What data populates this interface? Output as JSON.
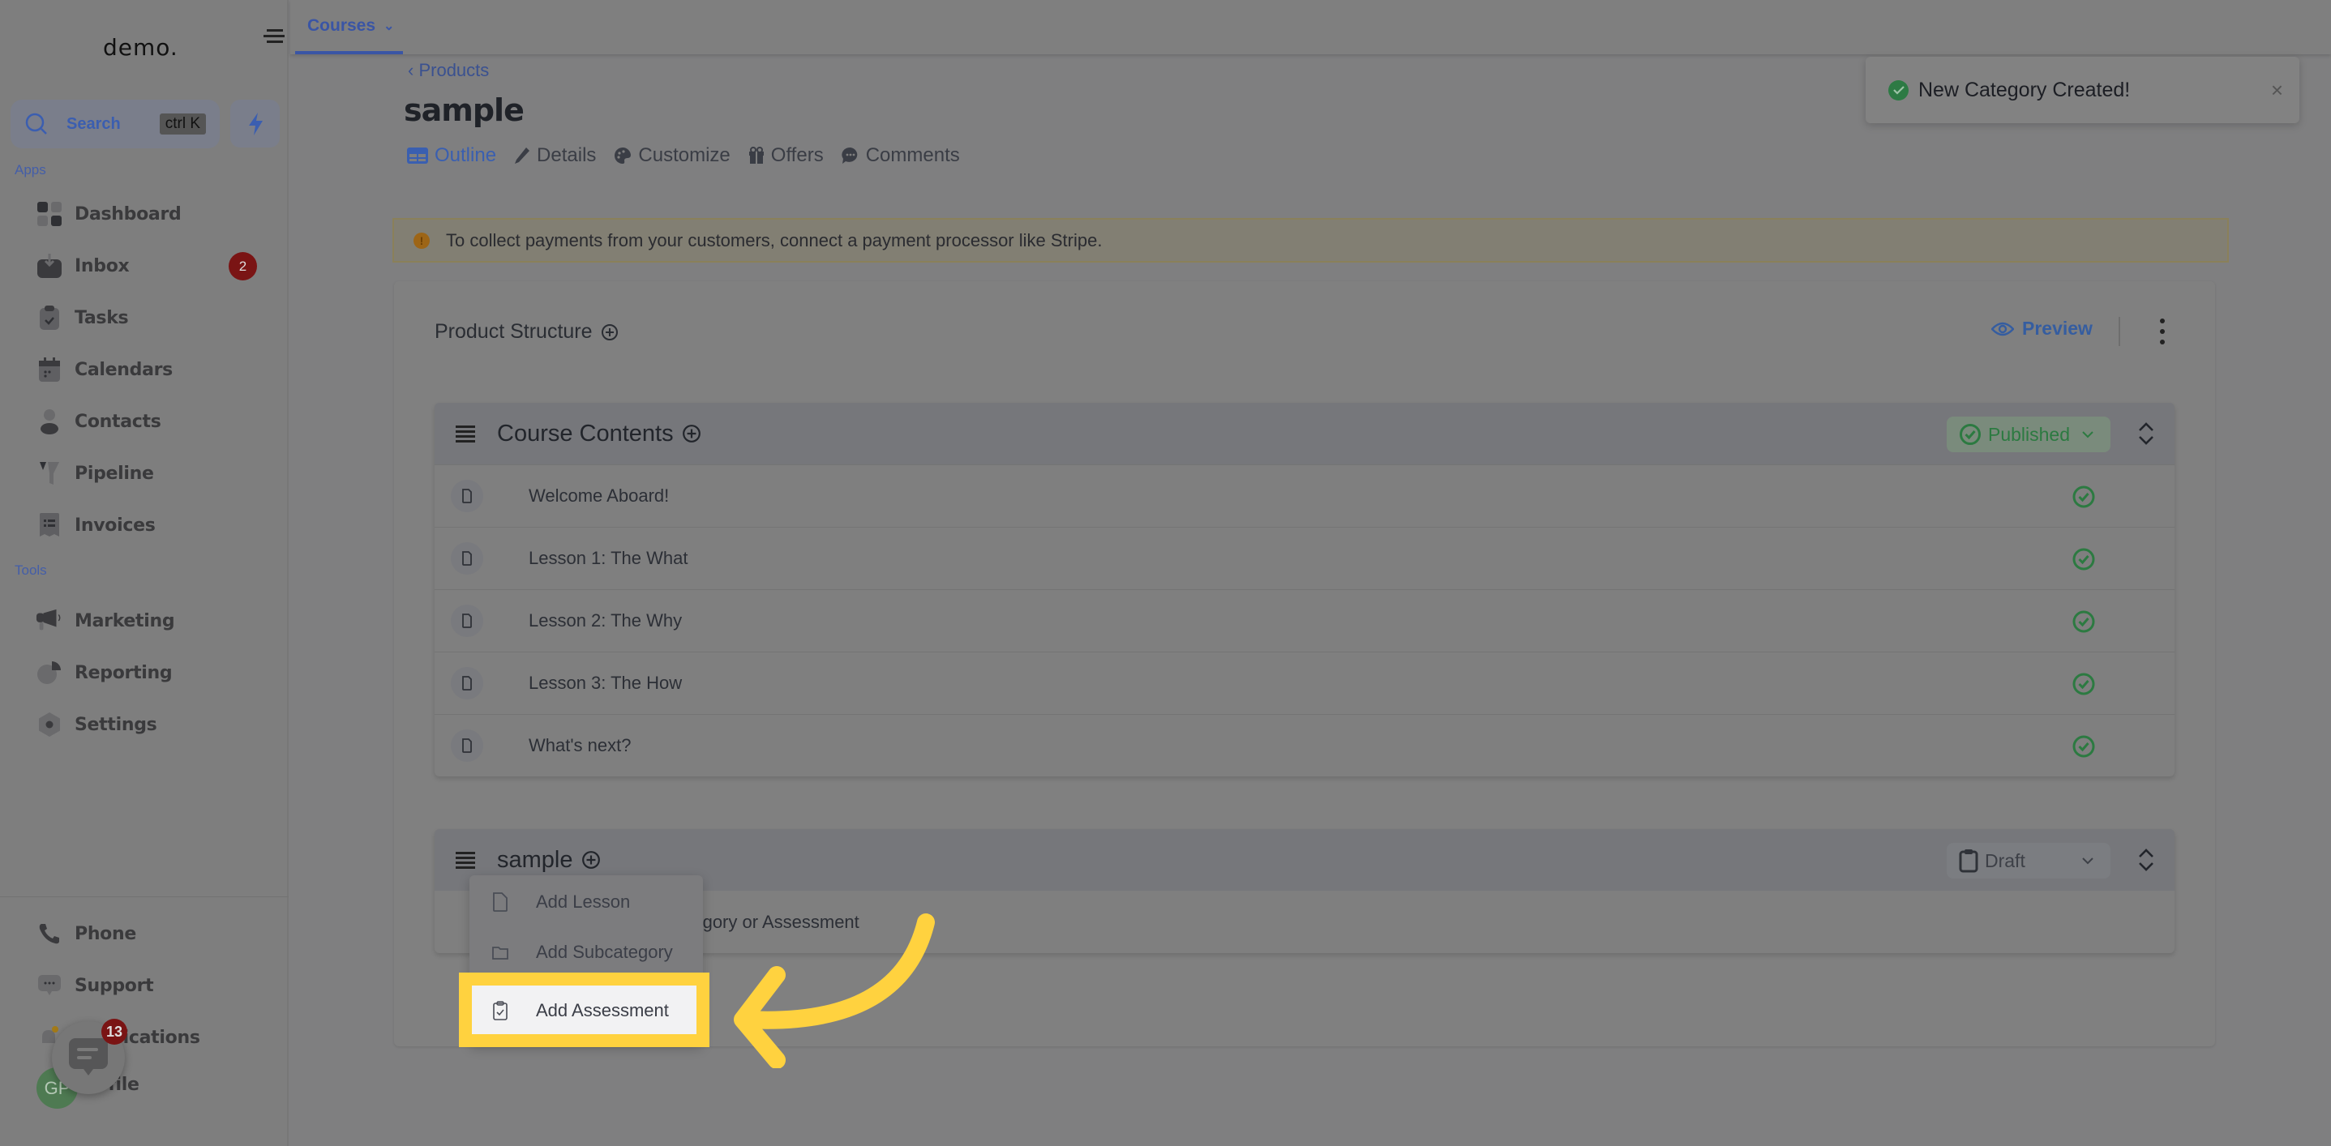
{
  "app": {
    "logo": "demo.",
    "search": {
      "label": "Search",
      "shortcut": "ctrl K"
    }
  },
  "sidebar": {
    "apps_label": "Apps",
    "tools_label": "Tools",
    "apps": [
      {
        "label": "Dashboard",
        "icon": "dashboard-icon"
      },
      {
        "label": "Inbox",
        "icon": "inbox-icon",
        "badge": "2"
      },
      {
        "label": "Tasks",
        "icon": "tasks-icon"
      },
      {
        "label": "Calendars",
        "icon": "calendar-icon"
      },
      {
        "label": "Contacts",
        "icon": "contacts-icon"
      },
      {
        "label": "Pipeline",
        "icon": "pipeline-icon"
      },
      {
        "label": "Invoices",
        "icon": "invoices-icon"
      }
    ],
    "tools": [
      {
        "label": "Marketing",
        "icon": "megaphone-icon"
      },
      {
        "label": "Reporting",
        "icon": "pie-chart-icon"
      },
      {
        "label": "Settings",
        "icon": "settings-icon"
      }
    ],
    "bottom": [
      {
        "label": "Phone",
        "icon": "phone-icon"
      },
      {
        "label": "Support",
        "icon": "support-icon"
      },
      {
        "label": "Notifications",
        "icon": "bell-icon"
      },
      {
        "label": "Profile",
        "icon": "avatar"
      }
    ],
    "avatar_initials": "GP",
    "chat_badge": "13"
  },
  "topbar": {
    "tab": "Courses"
  },
  "header": {
    "breadcrumb": "Products",
    "title": "sample",
    "tabs": [
      {
        "label": "Outline",
        "active": true
      },
      {
        "label": "Details"
      },
      {
        "label": "Customize"
      },
      {
        "label": "Offers"
      },
      {
        "label": "Comments"
      }
    ]
  },
  "toast": {
    "message": "New Category Created!"
  },
  "alert": {
    "message": "To collect payments from your customers, connect a payment processor like Stripe."
  },
  "structure": {
    "title": "Product Structure",
    "preview_label": "Preview",
    "categories": [
      {
        "name": "Course Contents",
        "status": "Published",
        "lessons": [
          {
            "title": "Welcome Aboard!",
            "published": true
          },
          {
            "title": "Lesson 1: The What",
            "published": true
          },
          {
            "title": "Lesson 2: The Why",
            "published": true
          },
          {
            "title": "Lesson 3: The How",
            "published": true
          },
          {
            "title": "What's next?",
            "published": true
          }
        ]
      },
      {
        "name": "sample",
        "status": "Draft",
        "empty_hint": "Add a Lesson, Subcategory or Assessment",
        "empty_hint_visible": "ategory or Assessment"
      }
    ]
  },
  "menu": {
    "items": [
      {
        "label": "Add Lesson",
        "icon": "document-icon"
      },
      {
        "label": "Add Subcategory",
        "icon": "folder-icon"
      },
      {
        "label": "Add Assessment",
        "icon": "clipboard-check-icon",
        "highlighted": true
      }
    ]
  },
  "colors": {
    "accent": "#3a55a5",
    "published": "#2c7a41",
    "highlight": "#ffd23f",
    "badge": "#7a1414"
  }
}
